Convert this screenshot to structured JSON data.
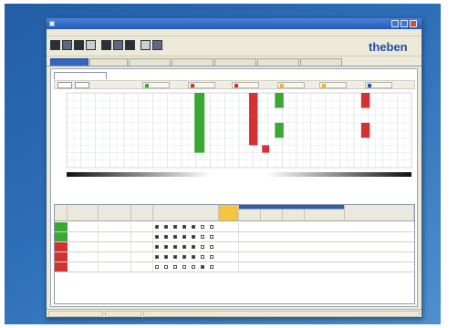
{
  "window": {
    "title": "",
    "controls": [
      "minimize-icon",
      "maximize-icon",
      "close-icon"
    ]
  },
  "menu": {
    "items": [
      "",
      "",
      "",
      "",
      ""
    ]
  },
  "toolbar": {
    "buttons": [
      "new-file-icon",
      "open-folder-icon",
      "save-icon",
      "print-icon",
      "cut-icon",
      "copy-icon",
      "paste-icon",
      "undo-icon",
      "settings-icon"
    ],
    "device_label": "",
    "logo_text": "theben"
  },
  "tabs": [
    "",
    "",
    "",
    "",
    "",
    "",
    ""
  ],
  "subtab": "",
  "filter": {
    "dropdown_1": "",
    "dropdown_2": "",
    "legend": [
      {
        "label": "",
        "color": "#3aa832"
      },
      {
        "label": "",
        "color": "#d23232"
      },
      {
        "label": "",
        "color": "#d23232"
      },
      {
        "label": "",
        "color": "#e8b628"
      },
      {
        "label": "",
        "color": "#e8b628"
      },
      {
        "label": "",
        "color": "#2b4fa8"
      }
    ]
  },
  "chart_data": {
    "type": "heatmap",
    "title": "",
    "xlabel": "",
    "ylabel": "",
    "x_range": [
      0,
      24
    ],
    "rows": 10,
    "grid": true,
    "row_labels": [],
    "x_tick_labels": [],
    "blocks": [
      {
        "row_start": 0,
        "row_end": 8,
        "x_start": 8.9,
        "x_end": 9.6,
        "color": "#3aa832"
      },
      {
        "row_start": 0,
        "row_end": 3,
        "x_start": 12.7,
        "x_end": 13.3,
        "color": "#d23232"
      },
      {
        "row_start": 3,
        "row_end": 7,
        "x_start": 12.7,
        "x_end": 13.3,
        "color": "#d23232"
      },
      {
        "row_start": 7,
        "row_end": 8,
        "x_start": 13.6,
        "x_end": 14.1,
        "color": "#d23232"
      },
      {
        "row_start": 0,
        "row_end": 2,
        "x_start": 14.5,
        "x_end": 15.1,
        "color": "#3aa832"
      },
      {
        "row_start": 4,
        "row_end": 6,
        "x_start": 14.5,
        "x_end": 15.1,
        "color": "#3aa832"
      },
      {
        "row_start": 0,
        "row_end": 2,
        "x_start": 20.5,
        "x_end": 21.1,
        "color": "#d23232"
      },
      {
        "row_start": 4,
        "row_end": 6,
        "x_start": 20.5,
        "x_end": 21.1,
        "color": "#d23232"
      }
    ],
    "gradient_bar": true
  },
  "table": {
    "headers": [
      "",
      "",
      "",
      "",
      "",
      "",
      "",
      "",
      "",
      "",
      "",
      ""
    ],
    "day_headers": [
      "",
      "",
      "",
      "",
      "",
      "",
      ""
    ],
    "rows": [
      {
        "status": "#3aa832",
        "cells": [
          "",
          "",
          "",
          ""
        ],
        "days": [
          true,
          true,
          true,
          true,
          true,
          false,
          false
        ]
      },
      {
        "status": "#3aa832",
        "cells": [
          "",
          "",
          "",
          ""
        ],
        "days": [
          true,
          true,
          true,
          true,
          true,
          false,
          false
        ]
      },
      {
        "status": "#d23232",
        "cells": [
          "",
          "",
          "",
          ""
        ],
        "days": [
          true,
          true,
          true,
          true,
          true,
          false,
          false
        ]
      },
      {
        "status": "#d23232",
        "cells": [
          "",
          "",
          "",
          ""
        ],
        "days": [
          true,
          true,
          true,
          true,
          true,
          false,
          false
        ]
      },
      {
        "status": "#d23232",
        "cells": [
          "",
          "",
          "",
          ""
        ],
        "days": [
          false,
          false,
          false,
          false,
          false,
          true,
          false
        ]
      }
    ]
  },
  "statusbar": {
    "left": "",
    "middle": ""
  },
  "colors": {
    "accent_blue": "#3566c0",
    "on_green": "#3aa832",
    "off_red": "#d23232",
    "highlight_orange": "#f5c542",
    "logo_blue": "#1e4fa6"
  }
}
